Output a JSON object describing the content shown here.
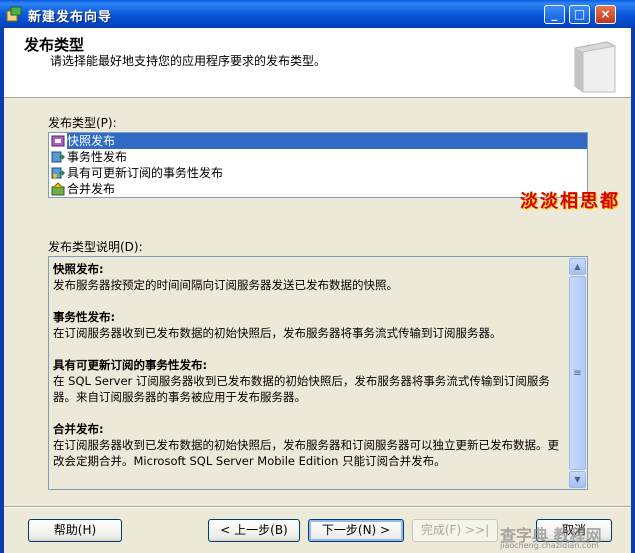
{
  "window": {
    "title": "新建发布向导",
    "minimize": "_",
    "maximize": "□",
    "close": "×"
  },
  "header": {
    "title": "发布类型",
    "subtitle": "请选择能最好地支持您的应用程序要求的发布类型。"
  },
  "publication_types": {
    "label": "发布类型(P):",
    "items": [
      {
        "label": "快照发布",
        "selected": true,
        "icon": "snapshot-icon"
      },
      {
        "label": "事务性发布",
        "selected": false,
        "icon": "transactional-icon"
      },
      {
        "label": "具有可更新订阅的事务性发布",
        "selected": false,
        "icon": "updatable-transactional-icon"
      },
      {
        "label": "合并发布",
        "selected": false,
        "icon": "merge-icon"
      }
    ]
  },
  "decoration": {
    "text": "淡淡相思都"
  },
  "description": {
    "label": "发布类型说明(D):",
    "sections": [
      {
        "heading": "快照发布:",
        "body": "发布服务器按预定的时间间隔向订阅服务器发送已发布数据的快照。"
      },
      {
        "heading": "事务性发布:",
        "body": "在订阅服务器收到已发布数据的初始快照后，发布服务器将事务流式传输到订阅服务器。"
      },
      {
        "heading": "具有可更新订阅的事务性发布:",
        "body": "在 SQL Server 订阅服务器收到已发布数据的初始快照后，发布服务器将事务流式传输到订阅服务器。来自订阅服务器的事务被应用于发布服务器。"
      },
      {
        "heading": "合并发布:",
        "body": "在订阅服务器收到已发布数据的初始快照后，发布服务器和订阅服务器可以独立更新已发布数据。更改会定期合并。Microsoft SQL Server Mobile Edition 只能订阅合并发布。"
      }
    ]
  },
  "buttons": {
    "help": "帮助(H)",
    "back": "< 上一步(B)",
    "next": "下一步(N) >",
    "finish": "完成(F) >>|",
    "cancel": "取消"
  },
  "watermark": {
    "text": "查字典 教程网",
    "url": "jiaocheng.chazidian.com"
  },
  "colors": {
    "titlebar": "#0b58d8",
    "selection": "#316ac5",
    "dialog_bg": "#ece9d8"
  }
}
